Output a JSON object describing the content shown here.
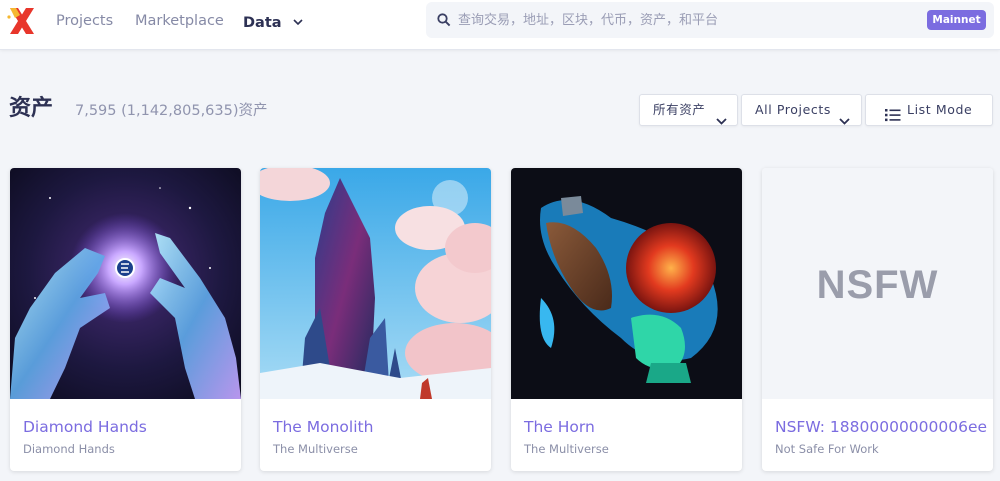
{
  "nav": {
    "logo": "x-logo",
    "items": [
      {
        "label": "Projects",
        "active": false
      },
      {
        "label": "Marketplace",
        "active": false
      },
      {
        "label": "Data",
        "active": true
      }
    ]
  },
  "search": {
    "placeholder": "查询交易，地址，区块，代币，资产，和平台",
    "network_badge": "Mainnet"
  },
  "page": {
    "title": "资产",
    "count": "7,595 (1,142,805,635)资产"
  },
  "filters": {
    "asset_type": "所有资产",
    "projects": "All Projects",
    "view_mode": "List Mode"
  },
  "cards": [
    {
      "name": "Diamond Hands",
      "collection": "Diamond Hands"
    },
    {
      "name": "The Monolith",
      "collection": "The Multiverse"
    },
    {
      "name": "The Horn",
      "collection": "The Multiverse"
    },
    {
      "name": "NSFW: 18800000000006ee",
      "collection": "Not Safe For Work",
      "placeholder_text": "NSFW"
    }
  ],
  "colors": {
    "accent": "#7b6ce0",
    "background": "#f3f5f9",
    "logo_red": "#e8362b",
    "logo_yellow": "#f5b731"
  }
}
